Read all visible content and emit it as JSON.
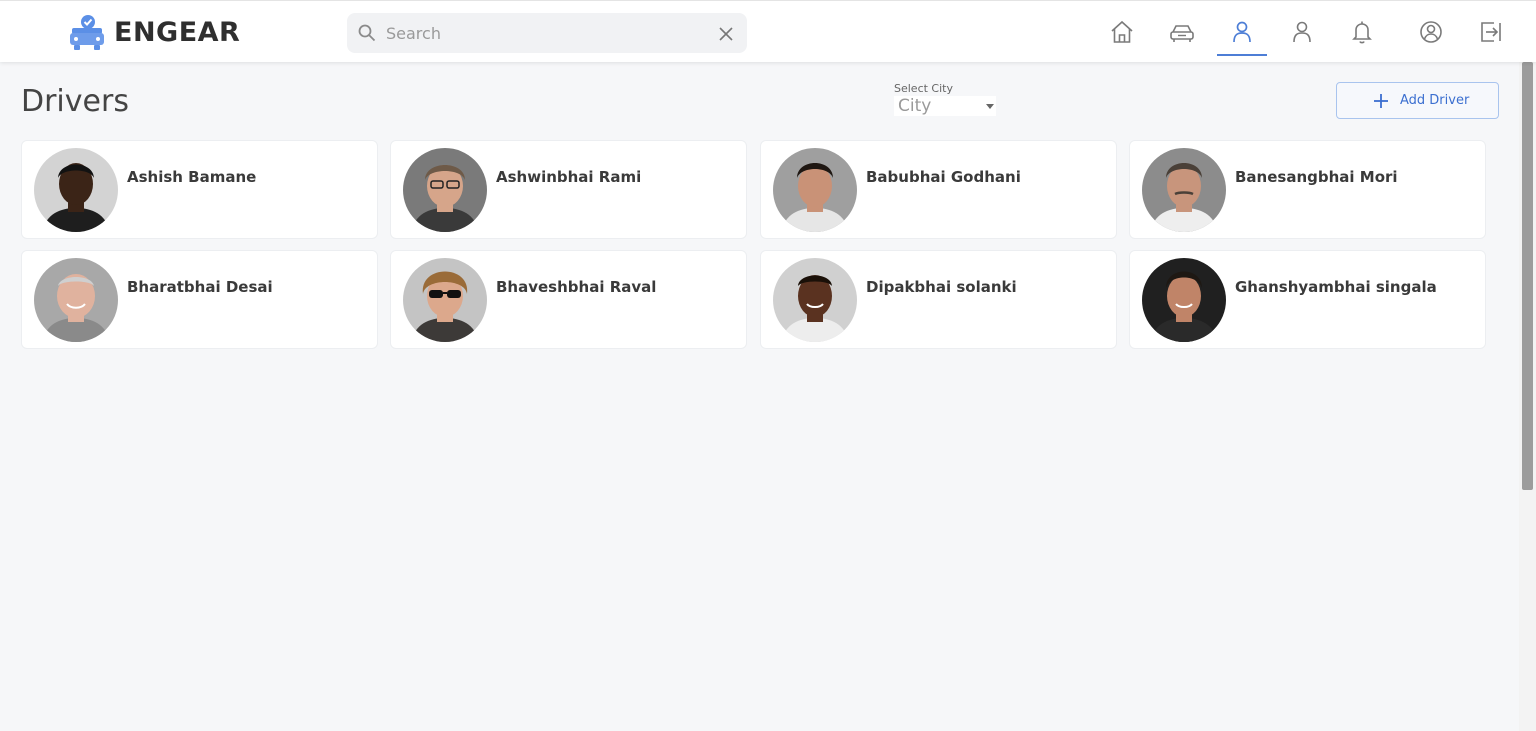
{
  "brand": {
    "name": "ENGEAR",
    "accent": "#4d7ed6"
  },
  "search": {
    "placeholder": "Search",
    "value": ""
  },
  "nav": [
    {
      "name": "home-icon",
      "active": false
    },
    {
      "name": "car-icon",
      "active": false
    },
    {
      "name": "drivers-icon",
      "active": true
    },
    {
      "name": "user-icon",
      "active": false
    },
    {
      "name": "bell-icon",
      "active": false
    },
    {
      "name": "account-icon",
      "active": false
    },
    {
      "name": "logout-icon",
      "active": false
    }
  ],
  "page": {
    "title": "Drivers",
    "city_label": "Select City",
    "city_value": "City",
    "add_label": "Add Driver"
  },
  "drivers": [
    {
      "name": "Ashish Bamane",
      "skin": "#3b2417",
      "hair": "#121212",
      "shirt": "#1e1e1e"
    },
    {
      "name": "Ashwinbhai Rami",
      "skin": "#d6a58a",
      "hair": "#6e5a48",
      "shirt": "#3a3a3a"
    },
    {
      "name": "Babubhai Godhani",
      "skin": "#c99277",
      "hair": "#1f1712",
      "shirt": "#e6e6e6"
    },
    {
      "name": "Banesangbhai Mori",
      "skin": "#c8957c",
      "hair": "#4a4038",
      "shirt": "#eeeeee"
    },
    {
      "name": "Bharatbhai Desai",
      "skin": "#e0b29e",
      "hair": "#cfcfcf",
      "shirt": "#8a8a8a"
    },
    {
      "name": "Bhaveshbhai Raval",
      "skin": "#dca88c",
      "hair": "#9a6b38",
      "shirt": "#3d3a38"
    },
    {
      "name": "Dipakbhai solanki",
      "skin": "#5a3220",
      "hair": "#1a1008",
      "shirt": "#ededed"
    },
    {
      "name": "Ghanshyambhai singala",
      "skin": "#c08468",
      "hair": "#1e1813",
      "shirt": "#2a2a2a"
    }
  ]
}
